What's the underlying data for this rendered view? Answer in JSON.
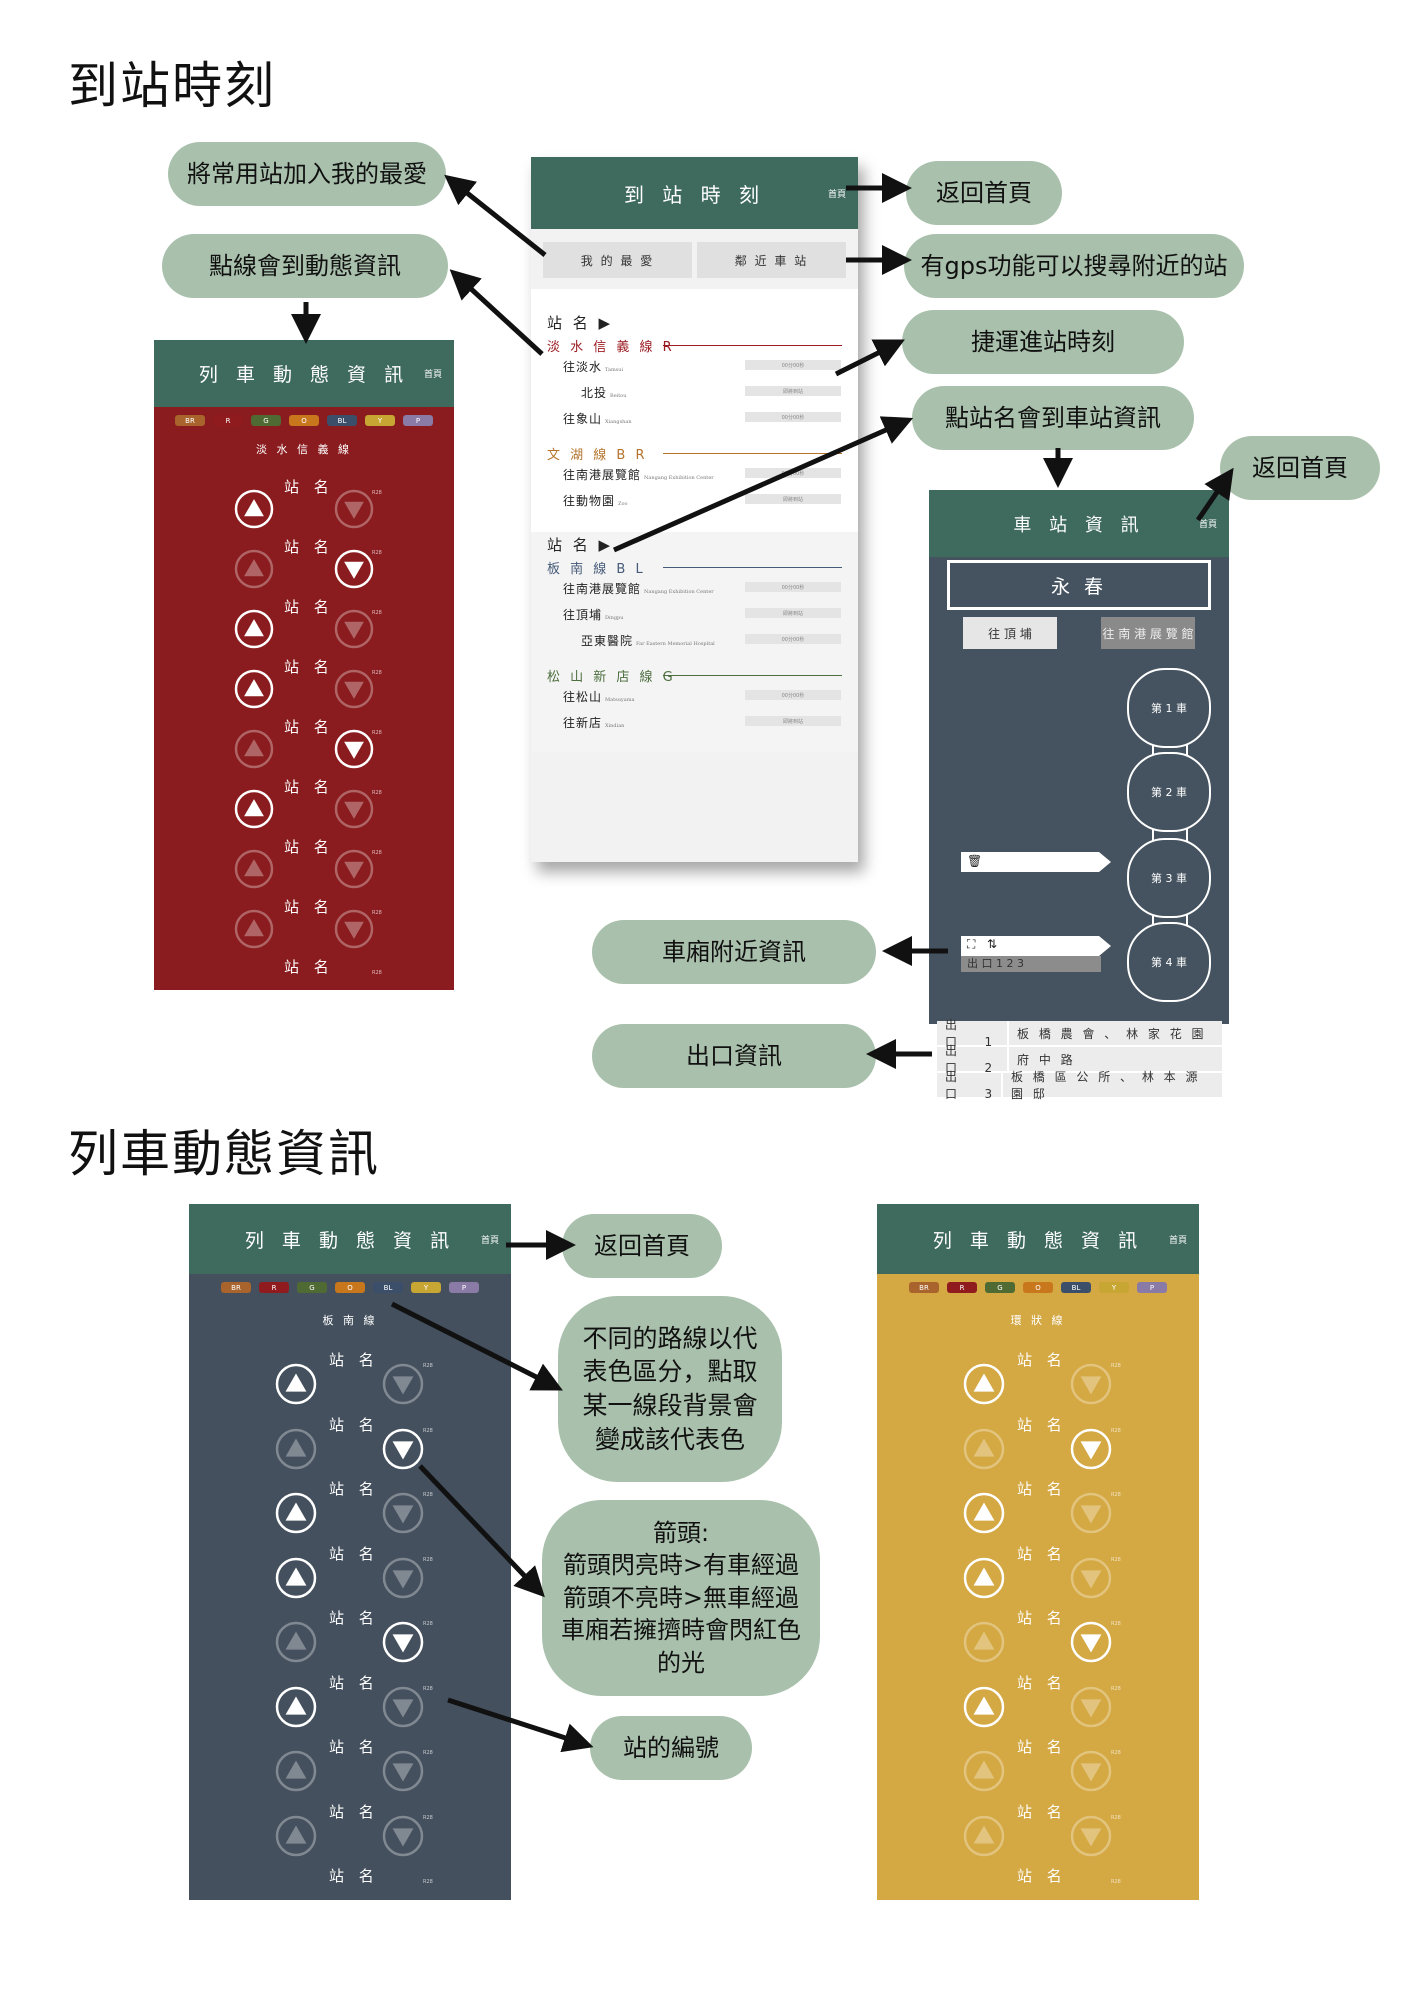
{
  "sections": {
    "arrival_title": "到站時刻",
    "train_title": "列車動態資訊"
  },
  "bubbles": {
    "add_fav": "將常用站加入我的最愛",
    "line_dynamic": "點線會到動態資訊",
    "home1": "返回首頁",
    "gps": "有gps功能可以搜尋附近的站",
    "mrt_times": "捷運進站時刻",
    "station_info": "點站名會到車站資訊",
    "home2": "返回首頁",
    "car_info": "車廂附近資訊",
    "exit_info": "出口資訊",
    "home3": "返回首頁",
    "line_colors": "不同的路線以代表色區分，點取某一線段背景會變成該代表色",
    "arrows": "箭頭:\n箭頭閃亮時>有車經過\n箭頭不亮時>無車經過\n車廂若擁擠時會閃紅色的光",
    "station_number": "站的編號"
  },
  "arrival_phone": {
    "title": "到 站 時 刻",
    "home": "首頁",
    "tab_fav": "我 的 最 愛",
    "tab_near": "鄰 近 車 站",
    "station_head": "站 名 ▶",
    "group1": {
      "line1": {
        "name": "淡 水 信 義 線 R",
        "color": "#9b1c22",
        "dirs": [
          {
            "label": "往淡水",
            "en": "Tamsui",
            "time": "00分00秒"
          },
          {
            "label": "北投",
            "en": "Beitou",
            "time": "即將到站"
          },
          {
            "label": "往象山",
            "en": "Xiangshan",
            "time": "00分00秒"
          }
        ]
      },
      "line2": {
        "name": "文 湖 線 B R",
        "color": "#b4742c",
        "dirs": [
          {
            "label": "往南港展覽館",
            "en": "Nangang Exhibition Center",
            "time": "00分00秒"
          },
          {
            "label": "往動物園",
            "en": "Zoo",
            "time": "即將到站"
          }
        ]
      }
    },
    "group2": {
      "line1": {
        "name": "板 南 線 B L",
        "color": "#455a78",
        "dirs": [
          {
            "label": "往南港展覽館",
            "en": "Nangang Exhibition Center",
            "time": "00分00秒"
          },
          {
            "label": "往頂埔",
            "en": "Dingpu",
            "time": "即將到站"
          },
          {
            "label": "亞東醫院",
            "en": "Far Eastern Memorial Hospital",
            "time": "00分00秒"
          }
        ]
      },
      "line2": {
        "name": "松 山 新 店 線 G",
        "color": "#4d6e3f",
        "dirs": [
          {
            "label": "往松山",
            "en": "Matsuyama",
            "time": "00分00秒"
          },
          {
            "label": "往新店",
            "en": "Xindian",
            "time": "即將到站"
          }
        ]
      }
    }
  },
  "chips": [
    "BR",
    "R",
    "G",
    "O",
    "BL",
    "Y",
    "P"
  ],
  "chip_colors": {
    "BR": "#a8642c",
    "R": "#8f1b1e",
    "G": "#4f6b33",
    "O": "#c8771c",
    "BL": "#3b4e6a",
    "Y": "#c7a634",
    "P": "#8a7aa6"
  },
  "train_red": {
    "title": "列 車 動 態 資 訊",
    "home": "首頁",
    "line": "淡 水 信 義 線",
    "bg": "#8a1b1e",
    "station": "站 名",
    "code": "R28",
    "up_bright": [
      true,
      false,
      true,
      true,
      false,
      true,
      false,
      false
    ],
    "down_bright": [
      false,
      true,
      false,
      false,
      true,
      false,
      false,
      false
    ]
  },
  "train_blue": {
    "title": "列 車 動 態 資 訊",
    "home": "首頁",
    "line": "板 南 線",
    "bg": "#44505e",
    "station": "站 名",
    "code": "R28",
    "up_bright": [
      true,
      false,
      true,
      true,
      false,
      true,
      false,
      false
    ],
    "down_bright": [
      false,
      true,
      false,
      false,
      true,
      false,
      false,
      false
    ]
  },
  "train_yellow": {
    "title": "列 車 動 態 資 訊",
    "home": "首頁",
    "line": "環 狀 線",
    "bg": "#d4a842",
    "station": "站 名",
    "code": "R28",
    "up_bright": [
      true,
      false,
      true,
      true,
      false,
      true,
      false,
      false
    ],
    "down_bright": [
      false,
      true,
      false,
      false,
      true,
      false,
      false,
      false
    ]
  },
  "station_phone": {
    "title": "車 站 資 訊",
    "home": "首頁",
    "name": "永 春",
    "dir_left": "往 頂 埔",
    "dir_right": "往 南 港 展 覽 館",
    "cars": [
      "第 1 車",
      "第 2 車",
      "第 3 車",
      "第 4 車"
    ],
    "exit_line": "出 口   1   2   3"
  },
  "exits": [
    {
      "label": "出 口",
      "num": "1",
      "dest": "板 橋 農 會 、 林 家 花 園"
    },
    {
      "label": "出 口",
      "num": "2",
      "dest": "府 中 路"
    },
    {
      "label": "出 口",
      "num": "3",
      "dest": "板 橋 區 公 所 、 林 本 源 園 邸"
    }
  ]
}
